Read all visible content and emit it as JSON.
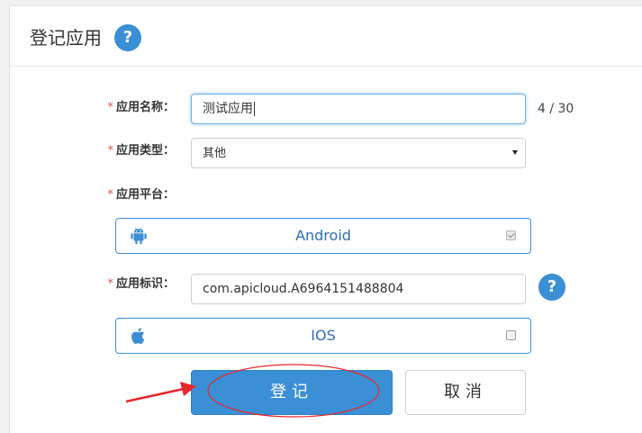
{
  "header": {
    "title": "登记应用",
    "help_label": "?"
  },
  "form": {
    "app_name": {
      "label": "应用名称：",
      "value": "测试应用",
      "counter": "4 / 30"
    },
    "app_type": {
      "label": "应用类型：",
      "selected": "其他"
    },
    "app_platform": {
      "label": "应用平台："
    },
    "app_id": {
      "label": "应用标识：",
      "value": "com.apicloud.A6964151488804",
      "help_label": "?"
    },
    "required_mark": "*"
  },
  "platforms": [
    {
      "name": "Android",
      "icon": "android-icon",
      "checked": true
    },
    {
      "name": "IOS",
      "icon": "apple-icon",
      "checked": false
    }
  ],
  "buttons": {
    "submit": "登记",
    "cancel": "取消"
  },
  "colors": {
    "accent": "#3b8fd5",
    "required": "#d9534f",
    "annotation": "#e8262b"
  }
}
